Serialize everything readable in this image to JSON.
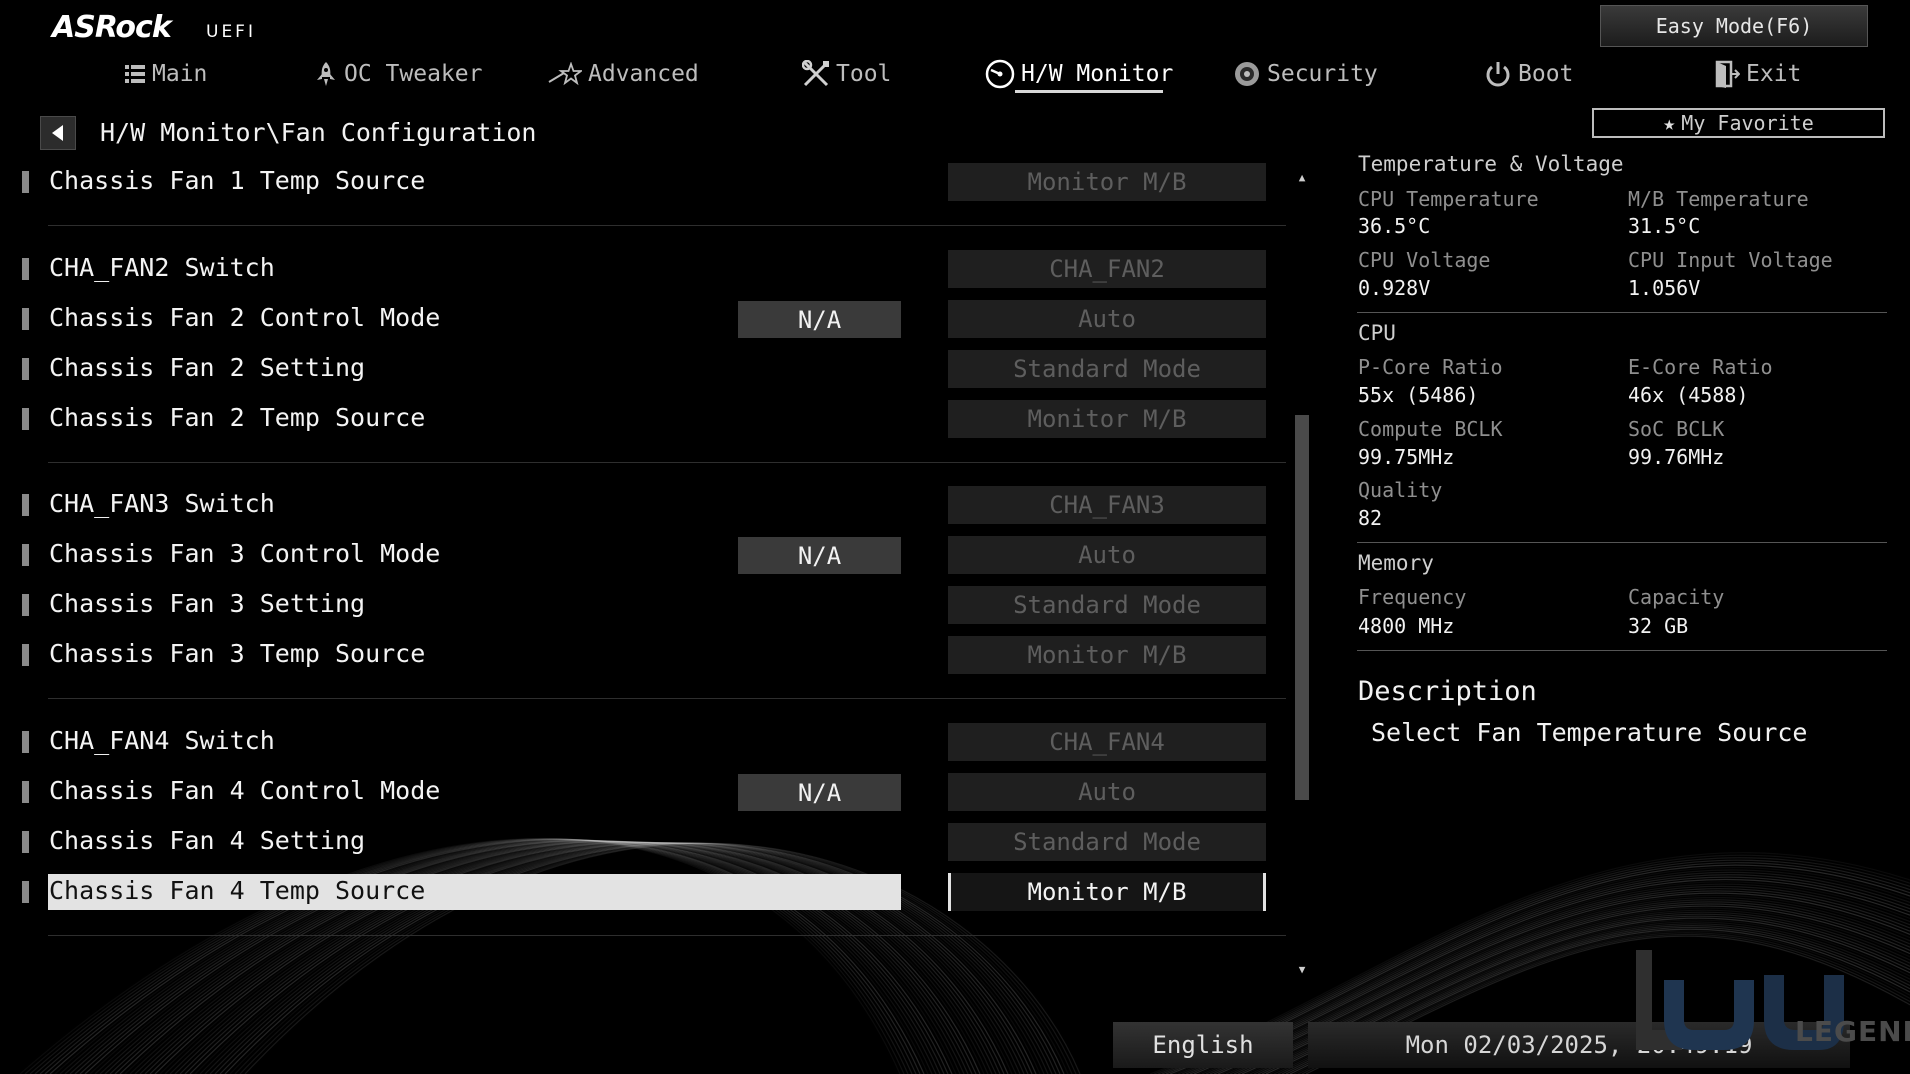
{
  "header": {
    "logo_text": "ASRock",
    "logo_sub": "UEFI",
    "easy_mode_label": "Easy Mode(F6)",
    "favorite_label": "My Favorite"
  },
  "tabs": [
    {
      "label": "Main",
      "icon": "list-icon",
      "active": false
    },
    {
      "label": "OC Tweaker",
      "icon": "rocket-icon",
      "active": false
    },
    {
      "label": "Advanced",
      "icon": "star-wand-icon",
      "active": false
    },
    {
      "label": "Tool",
      "icon": "wrench-screwdriver-icon",
      "active": false
    },
    {
      "label": "H/W Monitor",
      "icon": "gauge-icon",
      "active": true
    },
    {
      "label": "Security",
      "icon": "shield-icon",
      "active": false
    },
    {
      "label": "Boot",
      "icon": "power-icon",
      "active": false
    },
    {
      "label": "Exit",
      "icon": "door-exit-icon",
      "active": false
    }
  ],
  "breadcrumb": "H/W Monitor\\Fan Configuration",
  "settings": [
    {
      "label": "Chassis Fan 1 Temp Source",
      "na": null,
      "value": "Monitor M/B",
      "selected": false
    },
    {
      "label": "CHA_FAN2 Switch",
      "na": null,
      "value": "CHA_FAN2",
      "selected": false
    },
    {
      "label": "Chassis Fan 2 Control Mode",
      "na": "N/A",
      "value": "Auto",
      "selected": false
    },
    {
      "label": "Chassis Fan 2 Setting",
      "na": null,
      "value": "Standard Mode",
      "selected": false
    },
    {
      "label": "Chassis Fan 2 Temp Source",
      "na": null,
      "value": "Monitor M/B",
      "selected": false
    },
    {
      "label": "CHA_FAN3 Switch",
      "na": null,
      "value": "CHA_FAN3",
      "selected": false
    },
    {
      "label": "Chassis Fan 3 Control Mode",
      "na": "N/A",
      "value": "Auto",
      "selected": false
    },
    {
      "label": "Chassis Fan 3 Setting",
      "na": null,
      "value": "Standard Mode",
      "selected": false
    },
    {
      "label": "Chassis Fan 3 Temp Source",
      "na": null,
      "value": "Monitor M/B",
      "selected": false
    },
    {
      "label": "CHA_FAN4 Switch",
      "na": null,
      "value": "CHA_FAN4",
      "selected": false
    },
    {
      "label": "Chassis Fan 4 Control Mode",
      "na": "N/A",
      "value": "Auto",
      "selected": false
    },
    {
      "label": "Chassis Fan 4 Setting",
      "na": null,
      "value": "Standard Mode",
      "selected": false
    },
    {
      "label": "Chassis Fan 4 Temp Source",
      "na": null,
      "value": "Monitor M/B",
      "selected": true
    }
  ],
  "info": {
    "temp_voltage": {
      "title": "Temperature & Voltage",
      "cpu_temp_label": "CPU Temperature",
      "cpu_temp": "36.5°C",
      "mb_temp_label": "M/B Temperature",
      "mb_temp": "31.5°C",
      "cpu_voltage_label": "CPU Voltage",
      "cpu_voltage": "0.928V",
      "cpu_input_voltage_label": "CPU Input Voltage",
      "cpu_input_voltage": "1.056V"
    },
    "cpu": {
      "title": "CPU",
      "pcore_label": "P-Core Ratio",
      "pcore": "55x (5486)",
      "ecore_label": "E-Core Ratio",
      "ecore": "46x (4588)",
      "bclk_label": "Compute BCLK",
      "bclk": "99.75MHz",
      "soc_label": "SoC BCLK",
      "soc": "99.76MHz",
      "quality_label": "Quality",
      "quality": "82"
    },
    "memory": {
      "title": "Memory",
      "freq_label": "Frequency",
      "freq": "4800 MHz",
      "cap_label": "Capacity",
      "cap": "32 GB"
    }
  },
  "description": {
    "title": "Description",
    "text": "Select Fan Temperature Source"
  },
  "footer": {
    "language": "English",
    "datetime": "Mon 02/03/2025, 20:49:19"
  },
  "watermark": "LEGEND",
  "colors": {
    "background": "#000000",
    "highlight": "#e3e3e3",
    "na_box": "#3a3a3a",
    "value_box": "#1f1f1f"
  }
}
